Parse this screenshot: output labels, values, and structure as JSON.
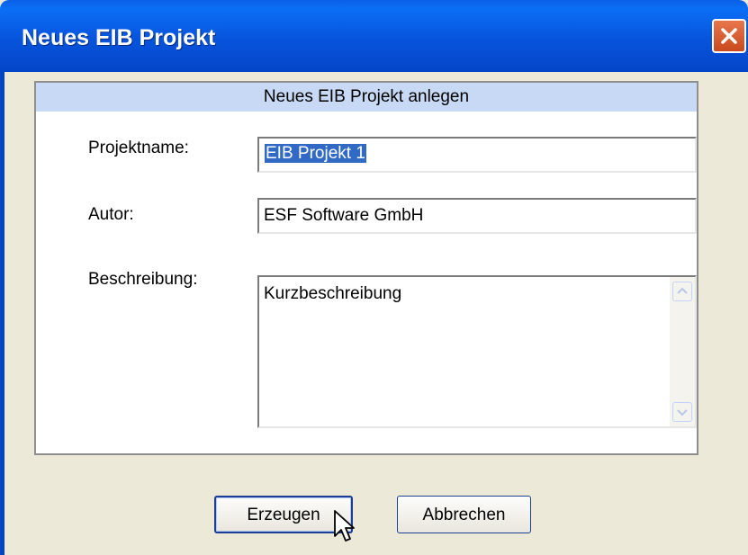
{
  "window": {
    "title": "Neues EIB Projekt"
  },
  "panel": {
    "header": "Neues EIB Projekt anlegen"
  },
  "fields": {
    "projektname_label": "Projektname:",
    "projektname_value": "EIB Projekt 1",
    "autor_label": "Autor:",
    "autor_value": "ESF Software GmbH",
    "beschreibung_label": "Beschreibung:",
    "beschreibung_value": "Kurzbeschreibung"
  },
  "buttons": {
    "create_label": "Erzeugen",
    "cancel_label": "Abbrechen"
  },
  "icons": {
    "close": "close-icon",
    "scroll_up": "chevron-up-icon",
    "scroll_down": "chevron-down-icon",
    "cursor": "mouse-pointer-icon"
  },
  "colors": {
    "titlebar": "#0754dc",
    "close_button": "#d6582c",
    "panel_header": "#c7d9f5",
    "selection": "#316ac5",
    "dialog_background": "#ece9d8"
  }
}
